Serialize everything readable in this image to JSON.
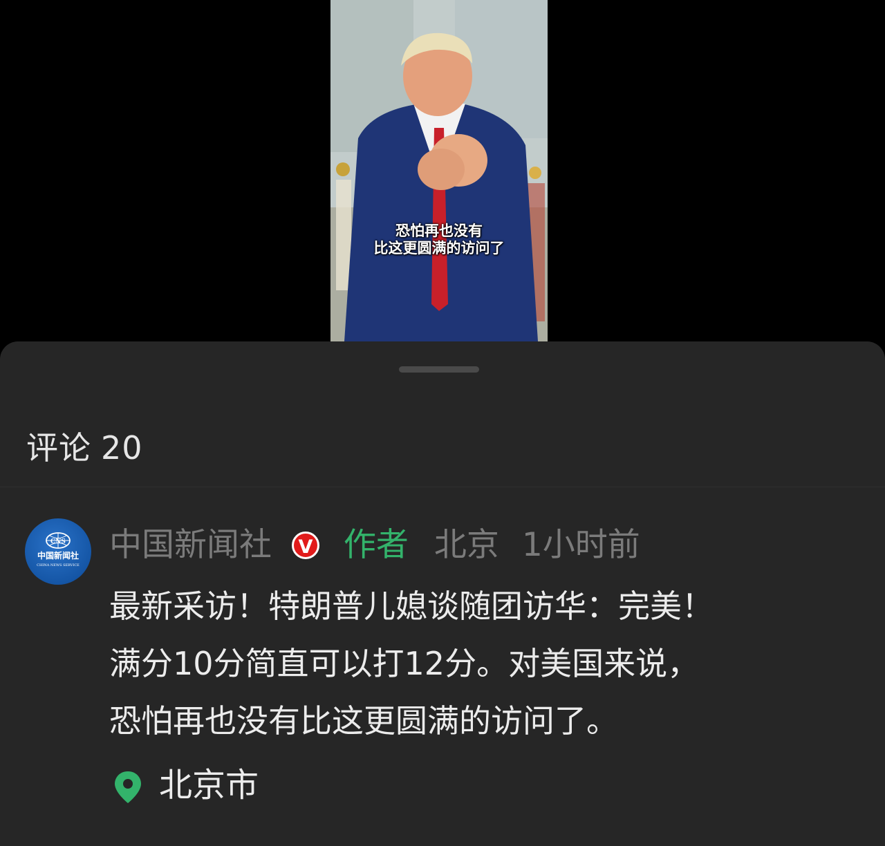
{
  "video": {
    "caption_line1": "恐怕再也没有",
    "caption_line2": "比这更圆满的访问了"
  },
  "comments": {
    "title": "评论",
    "count": "20"
  },
  "comment": {
    "author": "中国新闻社",
    "verified_badge": "V",
    "author_tag": "作者",
    "location": "北京",
    "time": "1小时前",
    "avatar_text": "CNS",
    "avatar_cn": "中国新闻社",
    "avatar_en": "CHINA NEWS SERVICE",
    "body_lines": [
      "最新采访！特朗普儿媳谈随团访华：完美！",
      "满分10分简直可以打12分。对美国来说，",
      "恐怕再也没有比这更圆满的访问了。"
    ],
    "location_label": "北京市"
  },
  "colors": {
    "sheet_bg": "#262626",
    "author_green": "#33b36b",
    "verified_red": "#e11b1b",
    "muted_text": "#7b7b7b"
  }
}
